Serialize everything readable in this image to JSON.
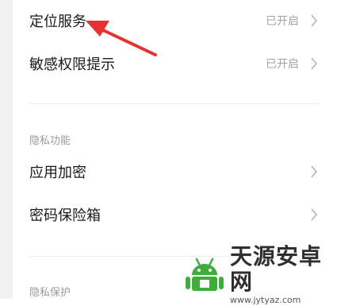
{
  "settings": {
    "location_service": {
      "label": "定位服务",
      "status": "已开启"
    },
    "sensitive_permission": {
      "label": "敏感权限提示",
      "status": "已开启"
    }
  },
  "privacy_features": {
    "title": "隐私功能",
    "items": [
      {
        "label": "应用加密"
      },
      {
        "label": "密码保险箱"
      }
    ]
  },
  "privacy_protection": {
    "title": "隐私保护"
  },
  "watermark": {
    "name": "天源安卓网",
    "url": "www.jytyaz.com"
  },
  "colors": {
    "annotation_arrow": "#e8302f",
    "logo_green": "#3dae3a"
  }
}
